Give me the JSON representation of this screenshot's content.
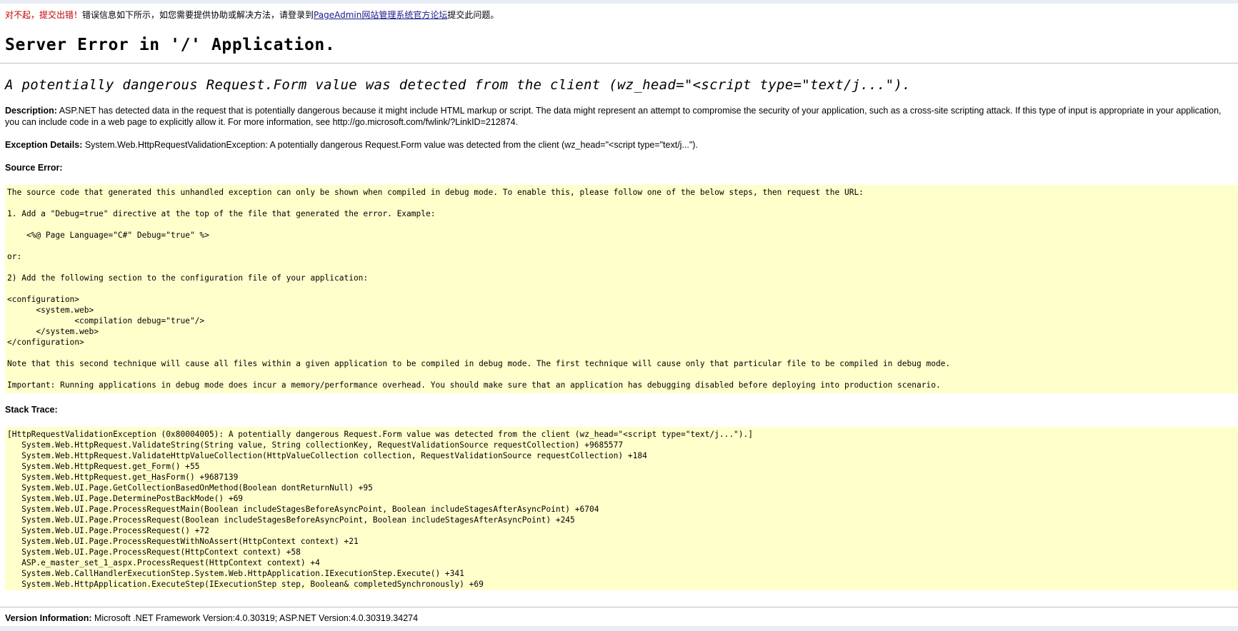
{
  "notice": {
    "sorry": "对不起，提交出错！",
    "before_link": "错误信息如下所示，如您需要提供协助或解决方法，请登录到",
    "link_text": "PageAdmin网站管理系统官方论坛",
    "after_link": "提交此问题。"
  },
  "title": "Server Error in '/' Application.",
  "subtitle": "A potentially dangerous Request.Form value was detected from the client (wz_head=\"<script type=\"text/j...\").",
  "description": {
    "label": "Description:",
    "text": " ASP.NET has detected data in the request that is potentially dangerous because it might include HTML markup or script. The data might represent an attempt to compromise the security of your application, such as a cross-site scripting attack. If this type of input is appropriate in your application, you can include code in a web page to explicitly allow it. For more information, see http://go.microsoft.com/fwlink/?LinkID=212874."
  },
  "exception": {
    "label": "Exception Details:",
    "text": " System.Web.HttpRequestValidationException: A potentially dangerous Request.Form value was detected from the client (wz_head=\"<script type=\"text/j...\")."
  },
  "source_error_label": "Source Error:",
  "source_lines": [
    "The source code that generated this unhandled exception can only be shown when compiled in debug mode. To enable this, please follow one of the below steps, then request the URL:",
    "",
    "1. Add a \"Debug=true\" directive at the top of the file that generated the error. Example:",
    "",
    "    <%@ Page Language=\"C#\" Debug=\"true\" %>",
    "",
    "or:",
    "",
    "2) Add the following section to the configuration file of your application:",
    "",
    "<configuration>",
    "      <system.web>",
    "              <compilation debug=\"true\"/>",
    "      </system.web>",
    "</configuration>",
    "",
    "Note that this second technique will cause all files within a given application to be compiled in debug mode. The first technique will cause only that particular file to be compiled in debug mode.",
    "",
    "Important: Running applications in debug mode does incur a memory/performance overhead. You should make sure that an application has debugging disabled before deploying into production scenario."
  ],
  "stack_trace_label": "Stack Trace:",
  "stack_lines": [
    "[HttpRequestValidationException (0x80004005): A potentially dangerous Request.Form value was detected from the client (wz_head=\"<script type=\"text/j...\").]",
    "   System.Web.HttpRequest.ValidateString(String value, String collectionKey, RequestValidationSource requestCollection) +9685577",
    "   System.Web.HttpRequest.ValidateHttpValueCollection(HttpValueCollection collection, RequestValidationSource requestCollection) +184",
    "   System.Web.HttpRequest.get_Form() +55",
    "   System.Web.HttpRequest.get_HasForm() +9687139",
    "   System.Web.UI.Page.GetCollectionBasedOnMethod(Boolean dontReturnNull) +95",
    "   System.Web.UI.Page.DeterminePostBackMode() +69",
    "   System.Web.UI.Page.ProcessRequestMain(Boolean includeStagesBeforeAsyncPoint, Boolean includeStagesAfterAsyncPoint) +6704",
    "   System.Web.UI.Page.ProcessRequest(Boolean includeStagesBeforeAsyncPoint, Boolean includeStagesAfterAsyncPoint) +245",
    "   System.Web.UI.Page.ProcessRequest() +72",
    "   System.Web.UI.Page.ProcessRequestWithNoAssert(HttpContext context) +21",
    "   System.Web.UI.Page.ProcessRequest(HttpContext context) +58",
    "   ASP.e_master_set_1_aspx.ProcessRequest(HttpContext context) +4",
    "   System.Web.CallHandlerExecutionStep.System.Web.HttpApplication.IExecutionStep.Execute() +341",
    "   System.Web.HttpApplication.ExecuteStep(IExecutionStep step, Boolean& completedSynchronously) +69"
  ],
  "version": {
    "label": "Version Information:",
    "text": " Microsoft .NET Framework Version:4.0.30319; ASP.NET Version:4.0.30319.34274"
  }
}
